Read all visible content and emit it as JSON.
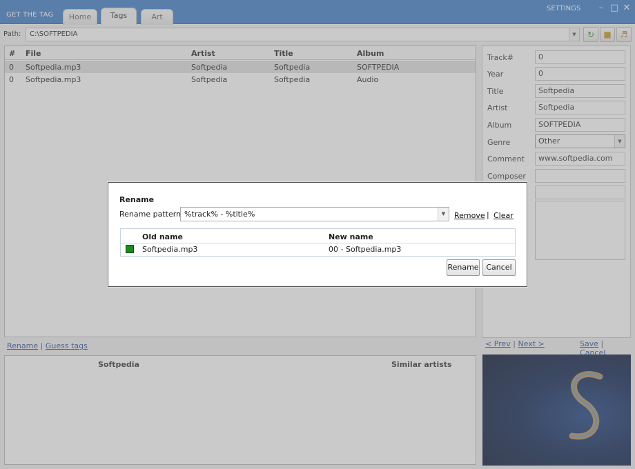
{
  "app": {
    "title": "GET THE TAG",
    "tabs": [
      "Home",
      "Tags",
      "Art"
    ],
    "active_tab": "Tags",
    "settings_label": "SETTINGS"
  },
  "path": {
    "label": "Path:",
    "value": "C:\\SOFTPEDIA"
  },
  "file_list": {
    "columns": [
      "#",
      "File",
      "Artist",
      "Title",
      "Album"
    ],
    "rows": [
      {
        "num": "0",
        "file": "Softpedia.mp3",
        "artist": "Softpedia",
        "title": "Softpedia",
        "album": "SOFTPEDIA"
      },
      {
        "num": "0",
        "file": "Softpedia.mp3",
        "artist": "Softpedia",
        "title": "Softpedia",
        "album": "Audio"
      }
    ]
  },
  "bottom_links": {
    "rename": "Rename",
    "separator": "|",
    "guess_tags": "Guess tags"
  },
  "info_panel": {
    "artist_heading": "Softpedia",
    "similar_heading": "Similar artists"
  },
  "tag_fields": {
    "track_label": "Track#",
    "track_value": "0",
    "year_label": "Year",
    "year_value": "0",
    "title_label": "Title",
    "title_value": "Softpedia",
    "artist_label": "Artist",
    "artist_value": "Softpedia",
    "album_label": "Album",
    "album_value": "SOFTPEDIA",
    "genre_label": "Genre",
    "genre_value": "Other",
    "comment_label": "Comment",
    "comment_value": "www.softpedia.com",
    "composer_label": "Composer",
    "composer_value": ""
  },
  "tag_nav": {
    "prev": "< Prev",
    "next": "Next >",
    "save": "Save",
    "cancel": "Cancel",
    "separator": "|"
  },
  "rename_dialog": {
    "title": "Rename",
    "pattern_label": "Rename pattern",
    "pattern_value": "%track% - %title%",
    "remove_link": "Remove",
    "separator": "|",
    "clear_link": "Clear",
    "columns": {
      "old": "Old name",
      "new": "New name"
    },
    "row": {
      "old": "Softpedia.mp3",
      "new": "00 - Softpedia.mp3",
      "checked": true
    },
    "rename_button": "Rename",
    "cancel_button": "Cancel"
  },
  "colors": {
    "titlebar": "#3d7cc9",
    "check_green": "#1f8a1f",
    "link_blue": "#2a4f9b"
  }
}
